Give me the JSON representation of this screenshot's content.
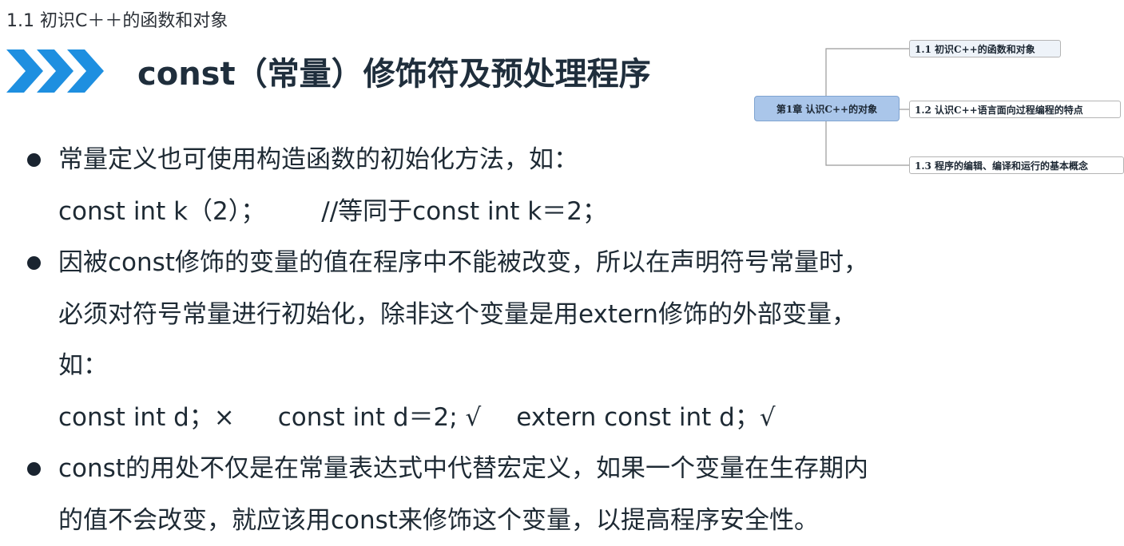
{
  "breadcrumb": "1.1 初识C＋＋的函数和对象",
  "title": "const（常量）修饰符及预处理程序",
  "colors": {
    "chevron": "#1e8fe0",
    "mindmap_root": "#aac6ea"
  },
  "mindmap": {
    "root": "第1章  认识C++的对象",
    "children": [
      "1.1 初识C++的函数和对象",
      "1.2 认识C++语言面向过程编程的特点",
      "1.3 程序的编辑、编译和运行的基本概念"
    ]
  },
  "content": {
    "bullet1": {
      "text": "常量定义也可使用构造函数的初始化方法，如：",
      "code": "const int k（2）；",
      "comment": "//等同于const int k＝2；"
    },
    "bullet2": {
      "line1": "因被const修饰的变量的值在程序中不能被改变，所以在声明符号常量时，",
      "line2": "必须对符号常量进行初始化，除非这个变量是用extern修饰的外部变量，",
      "line3": "如：",
      "example1": "const int d；×",
      "example2": "const int d＝2; √",
      "example3": "extern const int d；√"
    },
    "bullet3": {
      "line1": "const的用处不仅是在常量表达式中代替宏定义，如果一个变量在生存期内",
      "line2": "的值不会改变，就应该用const来修饰这个变量，以提高程序安全性。"
    }
  }
}
